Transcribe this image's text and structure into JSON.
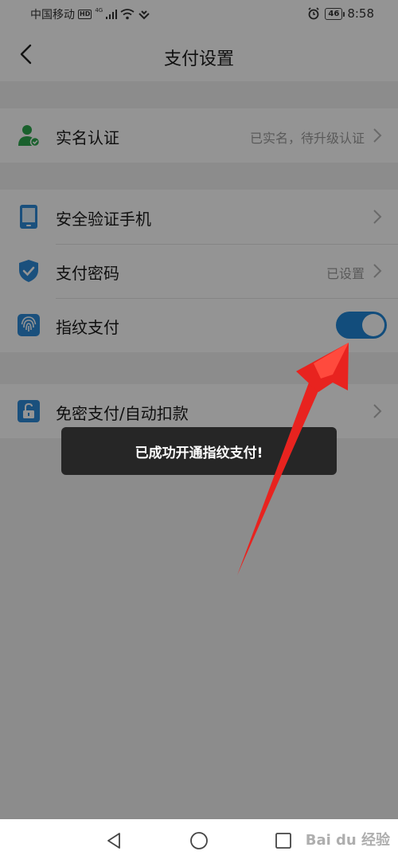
{
  "status_bar": {
    "carrier": "中国移动",
    "hd_badge": "HD",
    "signal_label": "4G",
    "battery": "46",
    "time": "8:58"
  },
  "nav": {
    "title": "支付设置",
    "back_icon": "chevron-left-icon"
  },
  "groups": [
    {
      "items": [
        {
          "label": "实名认证",
          "value": "已实名，待升级认证",
          "icon": "user-verified-icon",
          "has_chevron": true
        }
      ]
    },
    {
      "items": [
        {
          "label": "安全验证手机",
          "value": "",
          "icon": "phone-icon",
          "has_chevron": true
        },
        {
          "label": "支付密码",
          "value": "已设置",
          "icon": "shield-check-icon",
          "has_chevron": true
        },
        {
          "label": "指纹支付",
          "value": "",
          "icon": "fingerprint-icon",
          "toggle_on": true
        }
      ]
    },
    {
      "items": [
        {
          "label": "免密支付/自动扣款",
          "value": "",
          "icon": "unlock-icon",
          "has_chevron": true
        }
      ]
    }
  ],
  "toast": {
    "message": "已成功开通指纹支付!"
  },
  "watermark": "Bai du 经验",
  "colors": {
    "accent": "#1f86d6",
    "icon_green": "#2ea84e",
    "arrow_red": "#e8231f"
  }
}
